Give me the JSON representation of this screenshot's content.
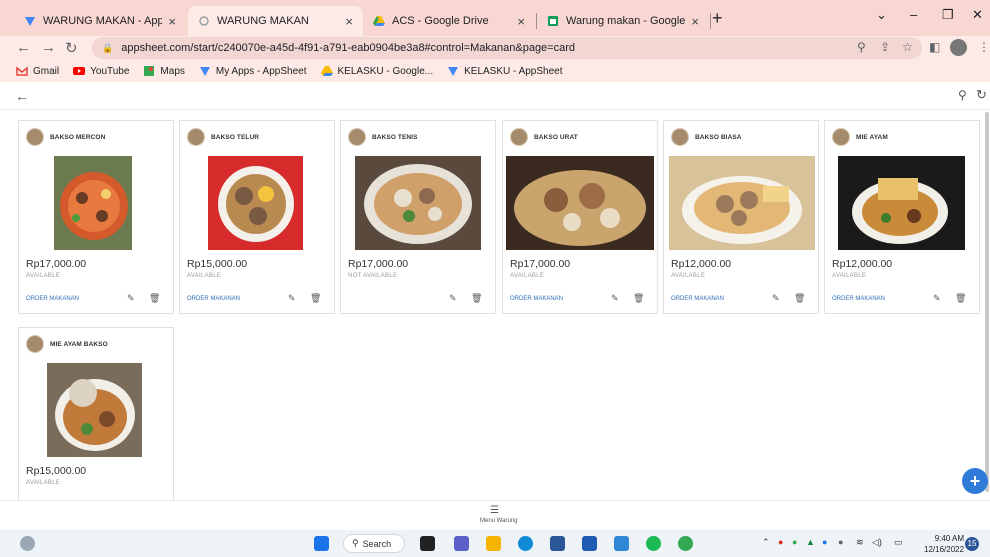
{
  "browser": {
    "tabs": [
      {
        "title": "WARUNG MAKAN - AppSheet",
        "close": "×"
      },
      {
        "title": "WARUNG MAKAN",
        "close": "×"
      },
      {
        "title": "ACS - Google Drive",
        "close": "×"
      },
      {
        "title": "Warung makan - Google Spreads",
        "close": "×"
      }
    ],
    "new_tab": "+",
    "window_controls": {
      "minimize_glyph": "⌄",
      "restore_glyph": "–",
      "maximize_glyph": "❐",
      "close_glyph": "✕"
    },
    "url": "appsheet.com/start/c240070e-a45d-4f91-a791-eab0904be3a8#control=Makanan&page=card",
    "bookmarks": [
      "Gmail",
      "YouTube",
      "Maps",
      "My Apps - AppSheet",
      "KELASKU - Google...",
      "KELASKU - AppSheet"
    ]
  },
  "app": {
    "cards": [
      {
        "name": "BAKSO MERCON",
        "price": "Rp17,000.00",
        "status": "AVAILABLE",
        "action": "ORDER MAKANAN"
      },
      {
        "name": "BAKSO TELUR",
        "price": "Rp15,000.00",
        "status": "AVAILABLE",
        "action": "ORDER MAKANAN"
      },
      {
        "name": "BAKSO TENIS",
        "price": "Rp17,000.00",
        "status": "NOT AVAILABLE",
        "action": ""
      },
      {
        "name": "BAKSO URAT",
        "price": "Rp17,000.00",
        "status": "AVAILABLE",
        "action": "ORDER MAKANAN"
      },
      {
        "name": "BAKSO BIASA",
        "price": "Rp12,000.00",
        "status": "AVAILABLE",
        "action": "ORDER MAKANAN"
      },
      {
        "name": "MIE AYAM",
        "price": "Rp12,000.00",
        "status": "AVAILABLE",
        "action": "ORDER MAKANAN"
      },
      {
        "name": "MIE AYAM BAKSO",
        "price": "Rp15,000.00",
        "status": "AVAILABLE",
        "action": ""
      }
    ],
    "bottom_nav_label": "Menu Warung",
    "fab_label": "+"
  },
  "taskbar": {
    "search": "Search",
    "time": "9:40 AM",
    "date": "12/16/2022",
    "notifications": "15"
  },
  "colors": {
    "tab_strip": "#f8d7d3",
    "accent": "#2e7bd8",
    "link": "#2f6fb7"
  }
}
